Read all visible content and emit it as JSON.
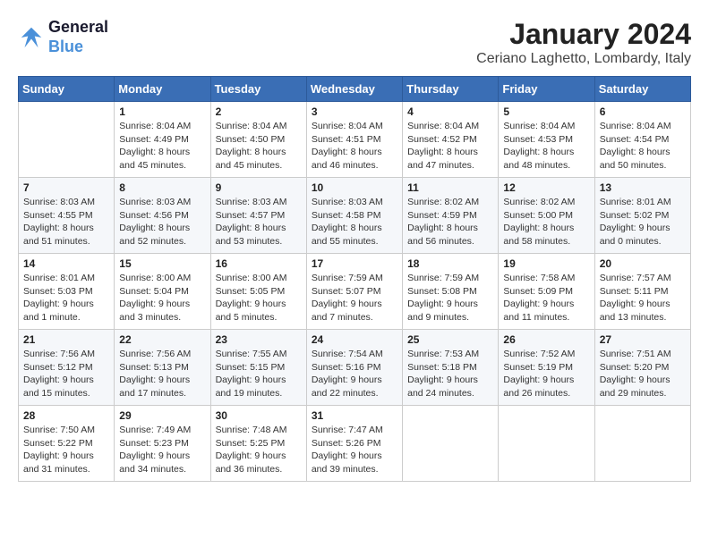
{
  "logo": {
    "line1": "General",
    "line2": "Blue"
  },
  "title": "January 2024",
  "subtitle": "Ceriano Laghetto, Lombardy, Italy",
  "weekdays": [
    "Sunday",
    "Monday",
    "Tuesday",
    "Wednesday",
    "Thursday",
    "Friday",
    "Saturday"
  ],
  "weeks": [
    [
      {
        "day": "",
        "sunrise": "",
        "sunset": "",
        "daylight": ""
      },
      {
        "day": "1",
        "sunrise": "Sunrise: 8:04 AM",
        "sunset": "Sunset: 4:49 PM",
        "daylight": "Daylight: 8 hours and 45 minutes."
      },
      {
        "day": "2",
        "sunrise": "Sunrise: 8:04 AM",
        "sunset": "Sunset: 4:50 PM",
        "daylight": "Daylight: 8 hours and 45 minutes."
      },
      {
        "day": "3",
        "sunrise": "Sunrise: 8:04 AM",
        "sunset": "Sunset: 4:51 PM",
        "daylight": "Daylight: 8 hours and 46 minutes."
      },
      {
        "day": "4",
        "sunrise": "Sunrise: 8:04 AM",
        "sunset": "Sunset: 4:52 PM",
        "daylight": "Daylight: 8 hours and 47 minutes."
      },
      {
        "day": "5",
        "sunrise": "Sunrise: 8:04 AM",
        "sunset": "Sunset: 4:53 PM",
        "daylight": "Daylight: 8 hours and 48 minutes."
      },
      {
        "day": "6",
        "sunrise": "Sunrise: 8:04 AM",
        "sunset": "Sunset: 4:54 PM",
        "daylight": "Daylight: 8 hours and 50 minutes."
      }
    ],
    [
      {
        "day": "7",
        "sunrise": "Sunrise: 8:03 AM",
        "sunset": "Sunset: 4:55 PM",
        "daylight": "Daylight: 8 hours and 51 minutes."
      },
      {
        "day": "8",
        "sunrise": "Sunrise: 8:03 AM",
        "sunset": "Sunset: 4:56 PM",
        "daylight": "Daylight: 8 hours and 52 minutes."
      },
      {
        "day": "9",
        "sunrise": "Sunrise: 8:03 AM",
        "sunset": "Sunset: 4:57 PM",
        "daylight": "Daylight: 8 hours and 53 minutes."
      },
      {
        "day": "10",
        "sunrise": "Sunrise: 8:03 AM",
        "sunset": "Sunset: 4:58 PM",
        "daylight": "Daylight: 8 hours and 55 minutes."
      },
      {
        "day": "11",
        "sunrise": "Sunrise: 8:02 AM",
        "sunset": "Sunset: 4:59 PM",
        "daylight": "Daylight: 8 hours and 56 minutes."
      },
      {
        "day": "12",
        "sunrise": "Sunrise: 8:02 AM",
        "sunset": "Sunset: 5:00 PM",
        "daylight": "Daylight: 8 hours and 58 minutes."
      },
      {
        "day": "13",
        "sunrise": "Sunrise: 8:01 AM",
        "sunset": "Sunset: 5:02 PM",
        "daylight": "Daylight: 9 hours and 0 minutes."
      }
    ],
    [
      {
        "day": "14",
        "sunrise": "Sunrise: 8:01 AM",
        "sunset": "Sunset: 5:03 PM",
        "daylight": "Daylight: 9 hours and 1 minute."
      },
      {
        "day": "15",
        "sunrise": "Sunrise: 8:00 AM",
        "sunset": "Sunset: 5:04 PM",
        "daylight": "Daylight: 9 hours and 3 minutes."
      },
      {
        "day": "16",
        "sunrise": "Sunrise: 8:00 AM",
        "sunset": "Sunset: 5:05 PM",
        "daylight": "Daylight: 9 hours and 5 minutes."
      },
      {
        "day": "17",
        "sunrise": "Sunrise: 7:59 AM",
        "sunset": "Sunset: 5:07 PM",
        "daylight": "Daylight: 9 hours and 7 minutes."
      },
      {
        "day": "18",
        "sunrise": "Sunrise: 7:59 AM",
        "sunset": "Sunset: 5:08 PM",
        "daylight": "Daylight: 9 hours and 9 minutes."
      },
      {
        "day": "19",
        "sunrise": "Sunrise: 7:58 AM",
        "sunset": "Sunset: 5:09 PM",
        "daylight": "Daylight: 9 hours and 11 minutes."
      },
      {
        "day": "20",
        "sunrise": "Sunrise: 7:57 AM",
        "sunset": "Sunset: 5:11 PM",
        "daylight": "Daylight: 9 hours and 13 minutes."
      }
    ],
    [
      {
        "day": "21",
        "sunrise": "Sunrise: 7:56 AM",
        "sunset": "Sunset: 5:12 PM",
        "daylight": "Daylight: 9 hours and 15 minutes."
      },
      {
        "day": "22",
        "sunrise": "Sunrise: 7:56 AM",
        "sunset": "Sunset: 5:13 PM",
        "daylight": "Daylight: 9 hours and 17 minutes."
      },
      {
        "day": "23",
        "sunrise": "Sunrise: 7:55 AM",
        "sunset": "Sunset: 5:15 PM",
        "daylight": "Daylight: 9 hours and 19 minutes."
      },
      {
        "day": "24",
        "sunrise": "Sunrise: 7:54 AM",
        "sunset": "Sunset: 5:16 PM",
        "daylight": "Daylight: 9 hours and 22 minutes."
      },
      {
        "day": "25",
        "sunrise": "Sunrise: 7:53 AM",
        "sunset": "Sunset: 5:18 PM",
        "daylight": "Daylight: 9 hours and 24 minutes."
      },
      {
        "day": "26",
        "sunrise": "Sunrise: 7:52 AM",
        "sunset": "Sunset: 5:19 PM",
        "daylight": "Daylight: 9 hours and 26 minutes."
      },
      {
        "day": "27",
        "sunrise": "Sunrise: 7:51 AM",
        "sunset": "Sunset: 5:20 PM",
        "daylight": "Daylight: 9 hours and 29 minutes."
      }
    ],
    [
      {
        "day": "28",
        "sunrise": "Sunrise: 7:50 AM",
        "sunset": "Sunset: 5:22 PM",
        "daylight": "Daylight: 9 hours and 31 minutes."
      },
      {
        "day": "29",
        "sunrise": "Sunrise: 7:49 AM",
        "sunset": "Sunset: 5:23 PM",
        "daylight": "Daylight: 9 hours and 34 minutes."
      },
      {
        "day": "30",
        "sunrise": "Sunrise: 7:48 AM",
        "sunset": "Sunset: 5:25 PM",
        "daylight": "Daylight: 9 hours and 36 minutes."
      },
      {
        "day": "31",
        "sunrise": "Sunrise: 7:47 AM",
        "sunset": "Sunset: 5:26 PM",
        "daylight": "Daylight: 9 hours and 39 minutes."
      },
      {
        "day": "",
        "sunrise": "",
        "sunset": "",
        "daylight": ""
      },
      {
        "day": "",
        "sunrise": "",
        "sunset": "",
        "daylight": ""
      },
      {
        "day": "",
        "sunrise": "",
        "sunset": "",
        "daylight": ""
      }
    ]
  ]
}
